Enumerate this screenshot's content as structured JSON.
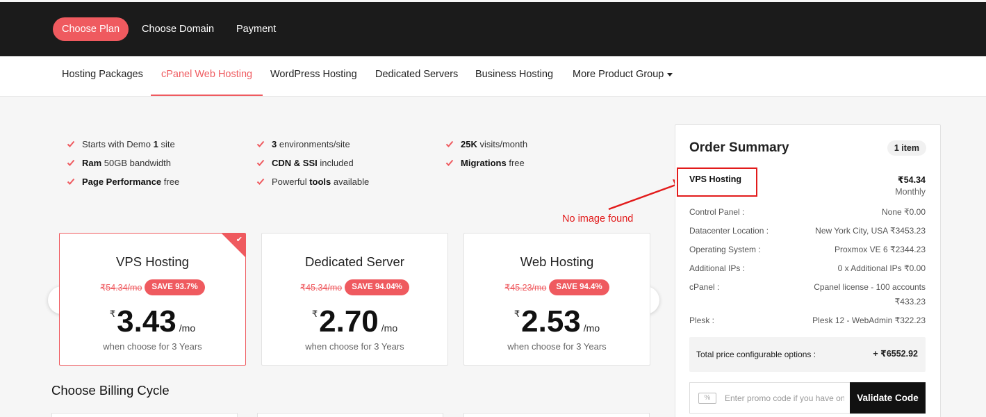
{
  "steps": [
    "Choose Plan",
    "Choose Domain",
    "Payment"
  ],
  "product_nav": {
    "tabs": [
      "Hosting Packages",
      "cPanel Web Hosting",
      "WordPress Hosting",
      "Dedicated Servers",
      "Business Hosting",
      "More Product Group"
    ],
    "active": "cPanel Web Hosting"
  },
  "features": [
    {
      "pre": "Starts with Demo ",
      "bold": "1",
      "post": " site"
    },
    {
      "pre": "",
      "bold": "3",
      "post": " environments/site"
    },
    {
      "pre": "",
      "bold": "25K",
      "post": " visits/month"
    },
    {
      "pre": "",
      "bold": "Ram",
      "post": " 50GB bandwidth"
    },
    {
      "pre": "",
      "bold": "CDN & SSI",
      "post": " included"
    },
    {
      "pre": "",
      "bold": "Migrations",
      "post": " free"
    },
    {
      "pre": "",
      "bold": "Page Performance",
      "post": " free"
    },
    {
      "pre": "Powerful ",
      "bold": "tools",
      "post": " available"
    }
  ],
  "annotation": {
    "no_image": "No image found"
  },
  "plans": [
    {
      "name": "VPS Hosting",
      "old_price": "₹54.34/mo",
      "save": "SAVE 93.7%",
      "currency": "₹",
      "price": "3.43",
      "per": "/mo",
      "note": "when choose for 3 Years",
      "selected": true
    },
    {
      "name": "Dedicated Server",
      "old_price": "₹45.34/mo",
      "save": "SAVE 94.04%",
      "currency": "₹",
      "price": "2.70",
      "per": "/mo",
      "note": "when choose for 3 Years",
      "selected": false
    },
    {
      "name": "Web Hosting",
      "old_price": "₹45.23/mo",
      "save": "SAVE 94.4%",
      "currency": "₹",
      "price": "2.53",
      "per": "/mo",
      "note": "when choose for 3 Years",
      "selected": false
    }
  ],
  "billing": {
    "title": "Choose Billing Cycle"
  },
  "summary": {
    "title": "Order Summary",
    "items_badge": "1 item",
    "product": "VPS Hosting",
    "product_price": "₹54.34",
    "product_cycle": "Monthly",
    "options": [
      {
        "label": "Control Panel :",
        "value": "None ₹0.00"
      },
      {
        "label": "Datacenter Location :",
        "value": "New York City, USA ₹3453.23"
      },
      {
        "label": "Operating System :",
        "value": "Proxmox VE 6 ₹2344.23"
      },
      {
        "label": "Additional IPs :",
        "value": "0 x Additional IPs ₹0.00"
      },
      {
        "label": "cPanel :",
        "value": "Cpanel license - 100 accounts",
        "value2": "₹433.23"
      },
      {
        "label": "Plesk :",
        "value": "Plesk 12 - WebAdmin ₹322.23"
      }
    ],
    "total_label": "Total price configurable options :",
    "total_value": "+ ₹6552.92",
    "promo_placeholder": "Enter promo code if you have one",
    "validate_label": "Validate Code"
  },
  "colors": {
    "accent": "#ef5a5f",
    "topbar": "#1b1b1b",
    "annotation": "#e21b1b"
  }
}
